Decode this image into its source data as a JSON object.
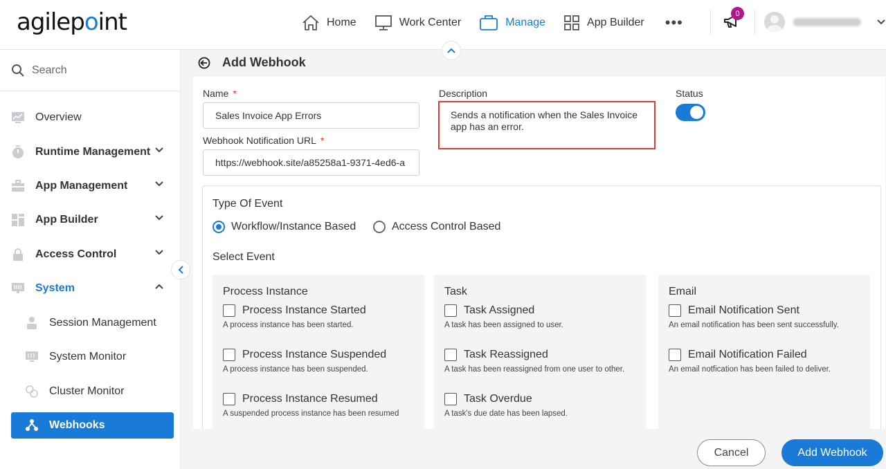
{
  "brand": {
    "logo_pre": "agilep",
    "logo_dot": "o",
    "logo_post": "int",
    "accent": "#1a7ad8"
  },
  "topnav": {
    "items": [
      {
        "label": "Home",
        "icon": "home-icon"
      },
      {
        "label": "Work Center",
        "icon": "monitor-icon"
      },
      {
        "label": "Manage",
        "icon": "briefcase-icon",
        "active": true
      },
      {
        "label": "App Builder",
        "icon": "grid-icon"
      }
    ],
    "more": "•••",
    "notifications": "0"
  },
  "sidebar": {
    "search_placeholder": "Search",
    "items": [
      {
        "label": "Overview",
        "icon": "overview-icon"
      },
      {
        "label": "Runtime Management",
        "icon": "timer-icon"
      },
      {
        "label": "App Management",
        "icon": "toolbox-icon"
      },
      {
        "label": "App Builder",
        "icon": "blocks-icon"
      },
      {
        "label": "Access Control",
        "icon": "lock-icon"
      },
      {
        "label": "System",
        "icon": "server-icon"
      },
      {
        "label": "Session Management",
        "icon": "session-icon"
      },
      {
        "label": "System Monitor",
        "icon": "monitor-icon"
      },
      {
        "label": "Cluster Monitor",
        "icon": "cluster-icon"
      },
      {
        "label": "Webhooks",
        "icon": "webhook-icon"
      }
    ]
  },
  "page": {
    "title": "Add Webhook"
  },
  "form": {
    "name_label": "Name",
    "name_value": "Sales Invoice App Errors",
    "url_label": "Webhook Notification URL",
    "url_value": "https://webhook.site/a85258a1-9371-4ed6-a",
    "required_mark": "*",
    "description_label": "Description",
    "description_value": "Sends a notification when the Sales Invoice app has an error.",
    "status_label": "Status",
    "status_on": true
  },
  "events": {
    "type_title": "Type Of Event",
    "type_options": [
      "Workflow/Instance Based",
      "Access Control Based"
    ],
    "select_title": "Select Event",
    "columns": [
      {
        "title": "Process Instance",
        "items": [
          {
            "label": "Process Instance Started",
            "desc": "A process instance has been started."
          },
          {
            "label": "Process Instance Suspended",
            "desc": "A process instance has been suspended."
          },
          {
            "label": "Process Instance Resumed",
            "desc": "A suspended process instance has been resumed"
          }
        ]
      },
      {
        "title": "Task",
        "items": [
          {
            "label": "Task Assigned",
            "desc": "A task has been assigned to user."
          },
          {
            "label": "Task Reassigned",
            "desc": "A task has been reassigned from one user to other."
          },
          {
            "label": "Task Overdue",
            "desc": "A task's due date has been lapsed."
          }
        ]
      },
      {
        "title": "Email",
        "items": [
          {
            "label": "Email Notification Sent",
            "desc": "An email notification has been sent successfully."
          },
          {
            "label": "Email Notification Failed",
            "desc": "An email notfication has been failed to deliver."
          }
        ]
      }
    ]
  },
  "buttons": {
    "cancel": "Cancel",
    "add": "Add Webhook"
  }
}
